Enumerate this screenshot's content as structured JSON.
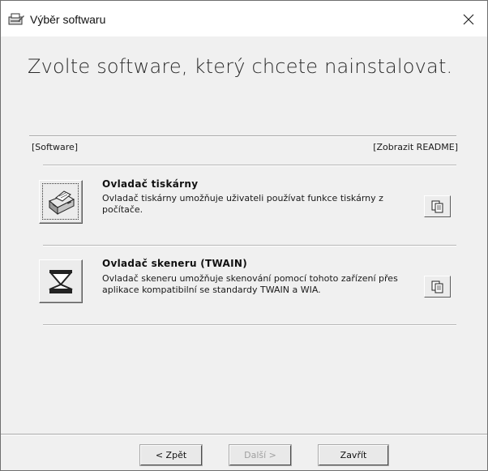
{
  "window": {
    "title": "Výběr softwaru",
    "close_glyph": "✕"
  },
  "main": {
    "heading": "Zvolte software, který chcete nainstalovat.",
    "columns": {
      "left": "[Software]",
      "right": "[Zobrazit README]"
    },
    "items": [
      {
        "title": "Ovladač tiskárny",
        "description": "Ovladač tiskárny umožňuje uživateli používat funkce tiskárny z počítače.",
        "icon": "printer-icon",
        "readme_icon": "readme-documents-icon"
      },
      {
        "title": "Ovladač skeneru (TWAIN)",
        "description": "Ovladač skeneru umožňuje skenování pomocí tohoto zařízení přes aplikace kompatibilní se standardy TWAIN a WIA.",
        "icon": "scanner-icon",
        "readme_icon": "readme-documents-icon"
      }
    ]
  },
  "footer": {
    "back_label": "< Zpět",
    "next_label": "Další >",
    "close_label": "Zavřít",
    "next_disabled": true
  }
}
